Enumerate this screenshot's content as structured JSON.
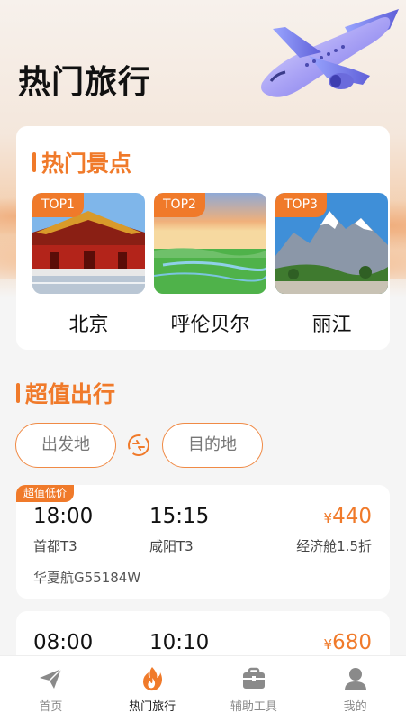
{
  "header": {
    "title": "热门旅行"
  },
  "hot_spots": {
    "title": "热门景点",
    "items": [
      {
        "rank": "TOP1",
        "name": "北京"
      },
      {
        "rank": "TOP2",
        "name": "呼伦贝尔"
      },
      {
        "rank": "TOP3",
        "name": "丽江"
      }
    ]
  },
  "deals": {
    "title": "超值出行",
    "from_placeholder": "出发地",
    "to_placeholder": "目的地"
  },
  "flights": [
    {
      "badge": "超值低价",
      "depart_time": "18:00",
      "arrive_time": "15:15",
      "depart_airport": "首都T3",
      "arrive_airport": "咸阳T3",
      "price_symbol": "¥",
      "price": "440",
      "cabin": "经济舱1.5折",
      "airline": "华夏航G55184W"
    },
    {
      "depart_time": "08:00",
      "arrive_time": "10:10",
      "price_symbol": "¥",
      "price": "680"
    }
  ],
  "tabbar": {
    "items": [
      {
        "label": "首页",
        "icon": "paper-plane-icon"
      },
      {
        "label": "热门旅行",
        "icon": "flame-icon",
        "active": true
      },
      {
        "label": "辅助工具",
        "icon": "briefcase-icon"
      },
      {
        "label": "我的",
        "icon": "user-icon"
      }
    ]
  },
  "colors": {
    "accent": "#f07a2a",
    "tab_inactive": "#8a8a8a"
  }
}
